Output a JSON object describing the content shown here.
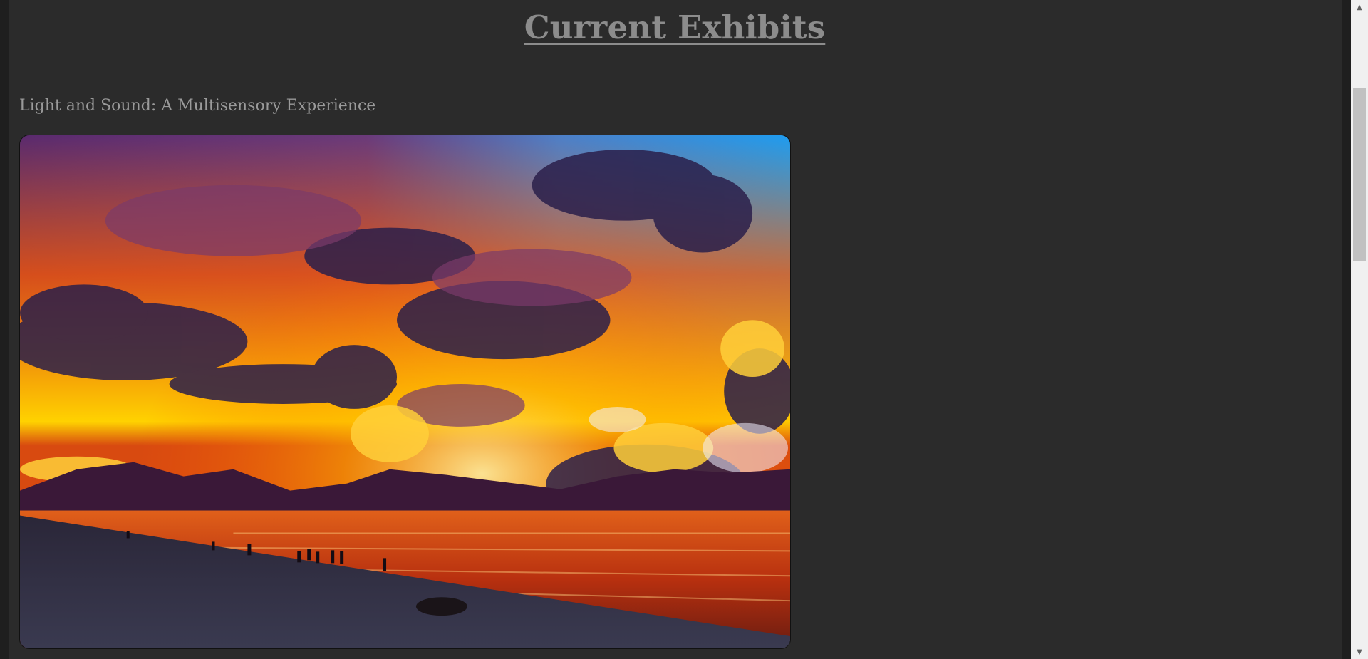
{
  "page": {
    "title": "Current Exhibits"
  },
  "exhibit": {
    "title": "Light and Sound: A Multisensory Experience",
    "image_alt": "Sunset over a beach with fiery orange clouds and purple sky"
  },
  "scrollbar": {
    "up_arrow": "▲",
    "down_arrow": "▼"
  },
  "colors": {
    "background": "#2b2b2b",
    "title": "#8c8c8c",
    "subtitle": "#9a9a9a"
  }
}
